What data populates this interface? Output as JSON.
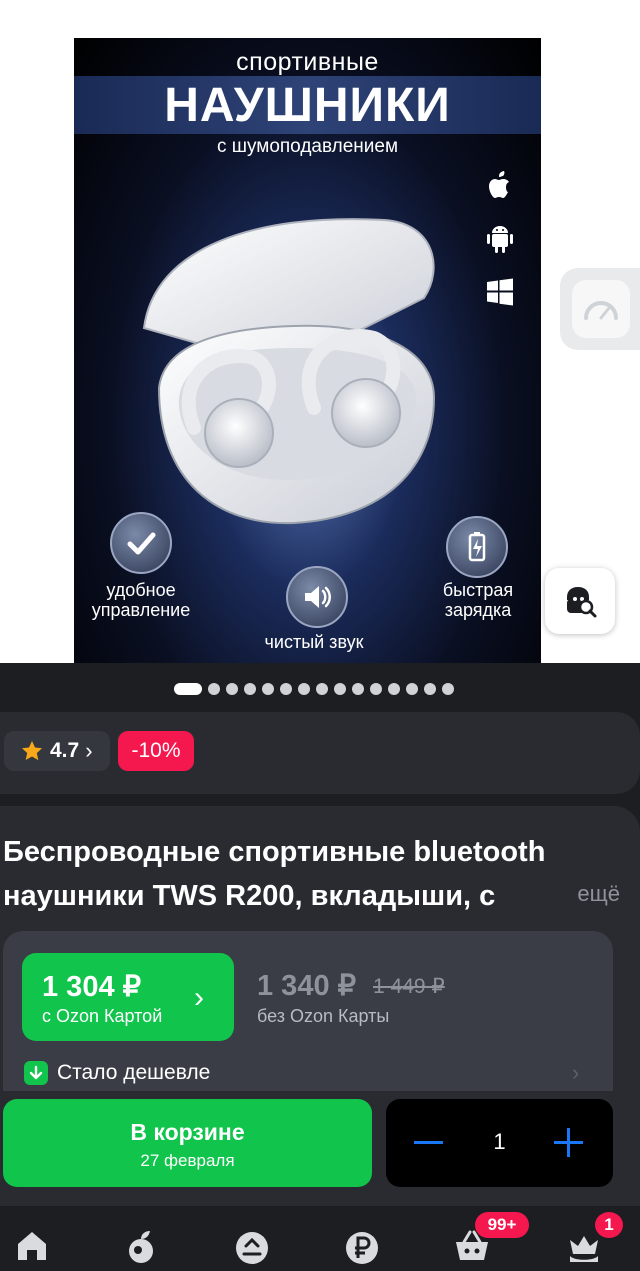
{
  "hero": {
    "subtitle_top": "спортивные",
    "title": "НАУШНИКИ",
    "subtitle_bottom": "с шумоподавлением",
    "os_icons": [
      "apple-icon",
      "android-icon",
      "windows-icon"
    ],
    "features": [
      {
        "icon": "checkmark-icon",
        "label_line1": "удобное",
        "label_line2": "управление"
      },
      {
        "icon": "speaker-icon",
        "label_line1": "чистый звук",
        "label_line2": ""
      },
      {
        "icon": "battery-charging-icon",
        "label_line1": "быстрая",
        "label_line2": "зарядка"
      }
    ]
  },
  "gallery": {
    "total_images": 15,
    "active_index": 0
  },
  "rating": {
    "value": "4.7",
    "chevron": "›",
    "discount": "-10%"
  },
  "product": {
    "title_line1": "Беспроводные спортивные bluetooth",
    "title_line2": "наушники TWS R200, вкладыши, с",
    "more_label": "ещё"
  },
  "pricing": {
    "ozon_card_price": "1 304 ₽",
    "ozon_card_caption": "с Ozon Картой",
    "regular_price": "1 340 ₽",
    "old_price": "1 449 ₽",
    "regular_caption": "без Ozon Карты",
    "cheaper_label": "Стало дешевле"
  },
  "cart": {
    "button_label": "В корзине",
    "delivery_date": "27 февраля",
    "quantity": "1"
  },
  "navbar": {
    "items": [
      "home-icon",
      "fresh-icon",
      "ozon-icon",
      "finance-icon",
      "cart-icon",
      "profile-icon"
    ],
    "cart_badge": "99+",
    "profile_badge": "1"
  },
  "colors": {
    "accent_green": "#10c44c",
    "discount_red": "#f5184f",
    "action_blue": "#1976f5",
    "card_bg": "#292b31"
  }
}
